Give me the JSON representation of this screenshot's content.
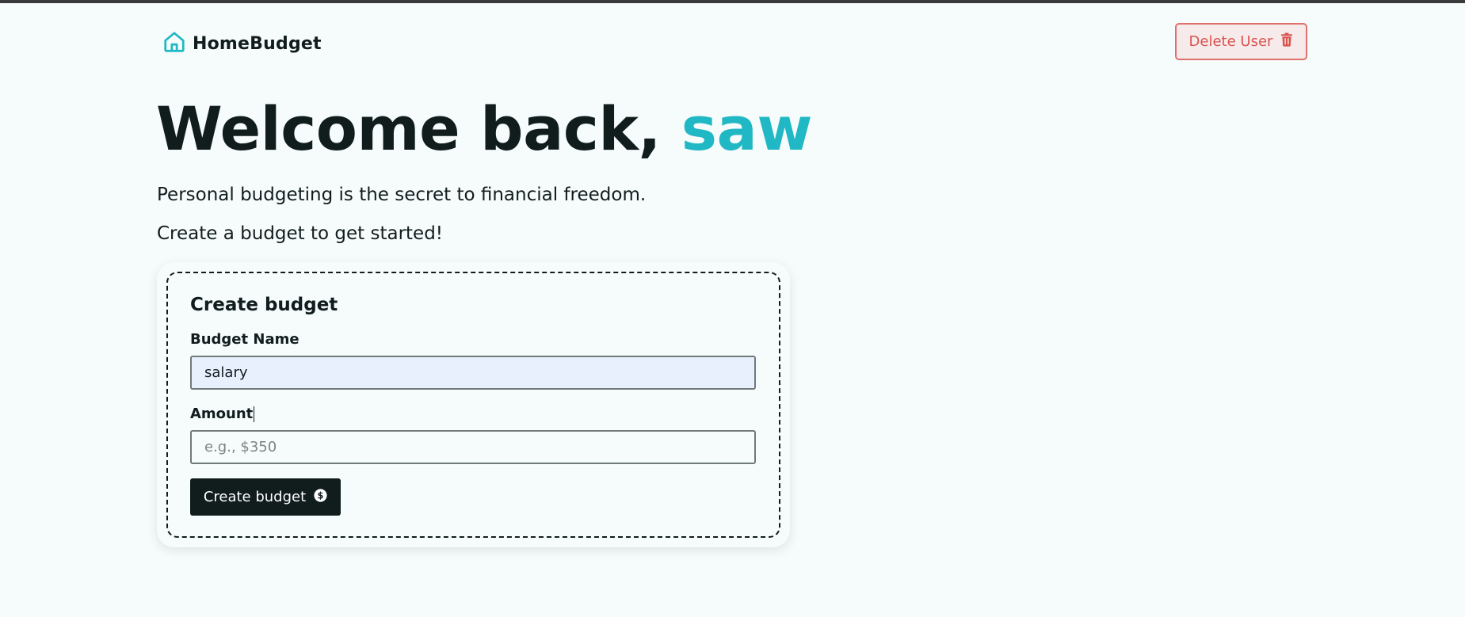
{
  "colors": {
    "accent": "#20b8c4",
    "primary_dark": "#111d1d",
    "danger": "#d9534f",
    "background": "#f6fbfb",
    "autofill_bg": "#e8f0fe"
  },
  "header": {
    "logo_icon": "home-icon",
    "logo_text": "HomeBudget",
    "delete_user_label": "Delete User",
    "delete_icon": "trash-icon"
  },
  "hero": {
    "greeting": "Welcome back,",
    "user_name": "saw",
    "tagline": "Personal budgeting is the secret to financial freedom.",
    "cta": "Create a budget to get started!"
  },
  "form": {
    "title": "Create budget",
    "name_label": "Budget Name",
    "name_value": "salary",
    "amount_label": "Amount",
    "amount_value": "",
    "amount_placeholder": "e.g., $350",
    "submit_label": "Create budget",
    "submit_icon": "dollar-circle-icon"
  }
}
